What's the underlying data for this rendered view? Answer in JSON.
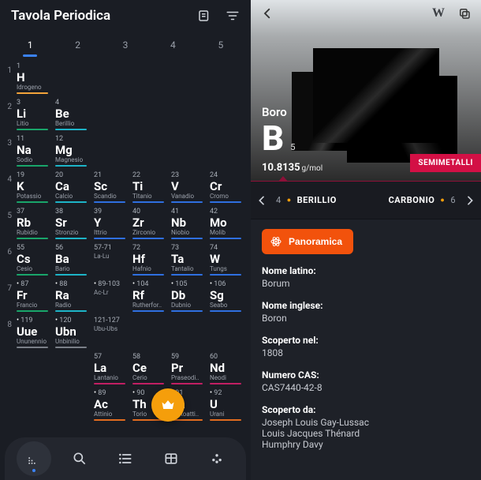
{
  "left": {
    "title": "Tavola Periodica",
    "tabs": [
      "1",
      "2",
      "3",
      "4",
      "5"
    ],
    "activeTab": 0,
    "rows": [
      {
        "period": "1",
        "cells": [
          {
            "num": "1",
            "sym": "H",
            "nm": "Idrogeno",
            "c": "#f2a33a"
          }
        ]
      },
      {
        "period": "2",
        "cells": [
          {
            "num": "3",
            "sym": "Li",
            "nm": "Litio",
            "c": "#19a56a"
          },
          {
            "num": "4",
            "sym": "Be",
            "nm": "Berillio",
            "c": "#1db4c7"
          }
        ]
      },
      {
        "period": "3",
        "cells": [
          {
            "num": "11",
            "sym": "Na",
            "nm": "Sodio",
            "c": "#19a56a"
          },
          {
            "num": "12",
            "sym": "Mg",
            "nm": "Magnesio",
            "c": "#1db4c7"
          }
        ]
      },
      {
        "period": "4",
        "cells": [
          {
            "num": "19",
            "sym": "K",
            "nm": "Potassio",
            "c": "#19a56a"
          },
          {
            "num": "20",
            "sym": "Ca",
            "nm": "Calcio",
            "c": "#1db4c7"
          },
          {
            "num": "21",
            "sym": "Sc",
            "nm": "Scandio",
            "c": "#2f6fe0"
          },
          {
            "num": "22",
            "sym": "Ti",
            "nm": "Titanio",
            "c": "#2f6fe0"
          },
          {
            "num": "23",
            "sym": "V",
            "nm": "Vanadio",
            "c": "#2f6fe0"
          },
          {
            "num": "24",
            "sym": "Cr",
            "nm": "Cromo",
            "c": "#2f6fe0"
          }
        ]
      },
      {
        "period": "5",
        "cells": [
          {
            "num": "37",
            "sym": "Rb",
            "nm": "Rubidio",
            "c": "#19a56a"
          },
          {
            "num": "38",
            "sym": "Sr",
            "nm": "Stronzio",
            "c": "#1db4c7"
          },
          {
            "num": "39",
            "sym": "Y",
            "nm": "Ittrio",
            "c": "#2f6fe0"
          },
          {
            "num": "40",
            "sym": "Zr",
            "nm": "Zirconio",
            "c": "#2f6fe0"
          },
          {
            "num": "41",
            "sym": "Nb",
            "nm": "Niobio",
            "c": "#2f6fe0"
          },
          {
            "num": "42",
            "sym": "Mo",
            "nm": "Molib",
            "c": "#2f6fe0"
          }
        ]
      },
      {
        "period": "6",
        "cells": [
          {
            "num": "55",
            "sym": "Cs",
            "nm": "Cesio",
            "c": "#19a56a"
          },
          {
            "num": "56",
            "sym": "Ba",
            "nm": "Bario",
            "c": "#1db4c7"
          },
          {
            "num": "57-71",
            "sym": "",
            "nm": "La-Lu",
            "c": "",
            "placeholder": true
          },
          {
            "num": "72",
            "sym": "Hf",
            "nm": "Hafnio",
            "c": "#2f6fe0"
          },
          {
            "num": "73",
            "sym": "Ta",
            "nm": "Tantalio",
            "c": "#2f6fe0"
          },
          {
            "num": "74",
            "sym": "W",
            "nm": "Tungs",
            "c": "#2f6fe0"
          }
        ]
      },
      {
        "period": "7",
        "cells": [
          {
            "num": "87",
            "sym": "Fr",
            "nm": "Francio",
            "c": "#19a56a",
            "dot": true
          },
          {
            "num": "88",
            "sym": "Ra",
            "nm": "Radio",
            "c": "#1db4c7",
            "dot": true
          },
          {
            "num": "89-103",
            "sym": "",
            "nm": "Ac-Lr",
            "c": "",
            "placeholder": true,
            "dot": true
          },
          {
            "num": "104",
            "sym": "Rf",
            "nm": "Rutherfor..",
            "c": "#2f6fe0",
            "dot": true
          },
          {
            "num": "105",
            "sym": "Db",
            "nm": "Dubnio",
            "c": "#2f6fe0",
            "dot": true
          },
          {
            "num": "106",
            "sym": "Sg",
            "nm": "Seabo",
            "c": "#2f6fe0",
            "dot": true
          }
        ]
      },
      {
        "period": "8",
        "cells": [
          {
            "num": "119",
            "sym": "Uue",
            "nm": "Ununennio",
            "c": "#7a7f88",
            "dot": true
          },
          {
            "num": "120",
            "sym": "Ubn",
            "nm": "Unbinilio",
            "c": "#7a7f88",
            "dot": true
          },
          {
            "num": "121-127",
            "sym": "",
            "nm": "Ubu-Ubs",
            "c": "",
            "placeholder": true
          }
        ]
      },
      {
        "period": "",
        "cells": [
          {
            "empty": true
          },
          {
            "empty": true
          },
          {
            "num": "57",
            "sym": "La",
            "nm": "Lantanio",
            "c": "#c11f63"
          },
          {
            "num": "58",
            "sym": "Ce",
            "nm": "Cerio",
            "c": "#c11f63"
          },
          {
            "num": "59",
            "sym": "Pr",
            "nm": "Praseodi..",
            "c": "#c11f63"
          },
          {
            "num": "60",
            "sym": "Nd",
            "nm": "Neodi",
            "c": "#c11f63"
          }
        ]
      },
      {
        "period": "",
        "cells": [
          {
            "empty": true
          },
          {
            "empty": true
          },
          {
            "num": "89",
            "sym": "Ac",
            "nm": "Attinio",
            "c": "#e06b1f",
            "dot": true
          },
          {
            "num": "90",
            "sym": "Th",
            "nm": "Torio",
            "c": "#e06b1f",
            "dot": true
          },
          {
            "num": "91",
            "sym": "Pa",
            "nm": "Protoatti..",
            "c": "#e06b1f",
            "dot": true
          },
          {
            "num": "92",
            "sym": "U",
            "nm": "Urani",
            "c": "#e06b1f",
            "dot": true
          }
        ]
      }
    ]
  },
  "right": {
    "element": {
      "name": "Boro",
      "symbol": "B",
      "z": "5",
      "mass": "10.8135",
      "massUnit": "g/mol",
      "category": "SEMIMETALLI"
    },
    "prev": {
      "num": "4",
      "name": "BERILLIO"
    },
    "next": {
      "num": "6",
      "name": "CARBONIO"
    },
    "overviewLabel": "Panoramica",
    "details": [
      {
        "label": "Nome latino:",
        "value": "Borum"
      },
      {
        "label": "Nome inglese:",
        "value": "Boron"
      },
      {
        "label": "Scoperto nel:",
        "value": "1808"
      },
      {
        "label": "Numero CAS:",
        "value": "CAS7440-42-8"
      },
      {
        "label": "Scoperto da:",
        "value": "Joseph Louis Gay-Lussac\nLouis Jacques Thénard\nHumphry Davy"
      }
    ]
  }
}
